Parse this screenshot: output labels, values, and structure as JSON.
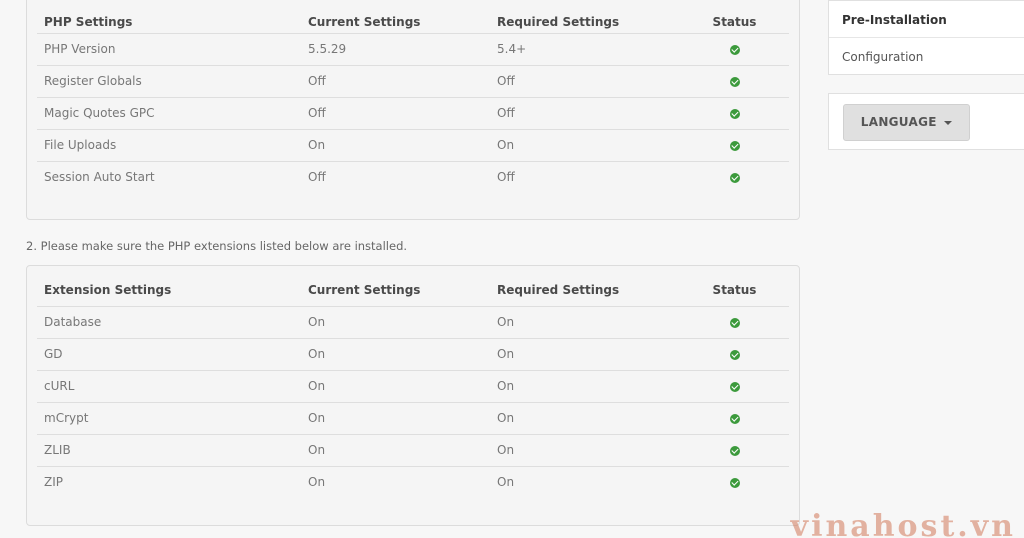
{
  "php_table": {
    "headers": [
      "PHP Settings",
      "Current Settings",
      "Required Settings",
      "Status"
    ],
    "rows": [
      {
        "name": "PHP Version",
        "current": "5.5.29",
        "required": "5.4+",
        "status": "ok"
      },
      {
        "name": "Register Globals",
        "current": "Off",
        "required": "Off",
        "status": "ok"
      },
      {
        "name": "Magic Quotes GPC",
        "current": "Off",
        "required": "Off",
        "status": "ok"
      },
      {
        "name": "File Uploads",
        "current": "On",
        "required": "On",
        "status": "ok"
      },
      {
        "name": "Session Auto Start",
        "current": "Off",
        "required": "Off",
        "status": "ok"
      }
    ]
  },
  "extensions_note": "2. Please make sure the PHP extensions listed below are installed.",
  "ext_table": {
    "headers": [
      "Extension Settings",
      "Current Settings",
      "Required Settings",
      "Status"
    ],
    "rows": [
      {
        "name": "Database",
        "current": "On",
        "required": "On",
        "status": "ok"
      },
      {
        "name": "GD",
        "current": "On",
        "required": "On",
        "status": "ok"
      },
      {
        "name": "cURL",
        "current": "On",
        "required": "On",
        "status": "ok"
      },
      {
        "name": "mCrypt",
        "current": "On",
        "required": "On",
        "status": "ok"
      },
      {
        "name": "ZLIB",
        "current": "On",
        "required": "On",
        "status": "ok"
      },
      {
        "name": "ZIP",
        "current": "On",
        "required": "On",
        "status": "ok"
      }
    ]
  },
  "sidebar": {
    "steps": [
      {
        "label": "Pre-Installation",
        "active": true
      },
      {
        "label": "Configuration",
        "active": false
      }
    ],
    "language_button": "LANGUAGE"
  },
  "watermark": "vinahost.vn",
  "colors": {
    "status_ok": "#3c9a3c",
    "panel_bg": "#f5f5f5",
    "button_bg": "#e0e0e0"
  },
  "icons": {
    "status_ok": "check-circle-icon",
    "dropdown": "caret-down-icon"
  }
}
